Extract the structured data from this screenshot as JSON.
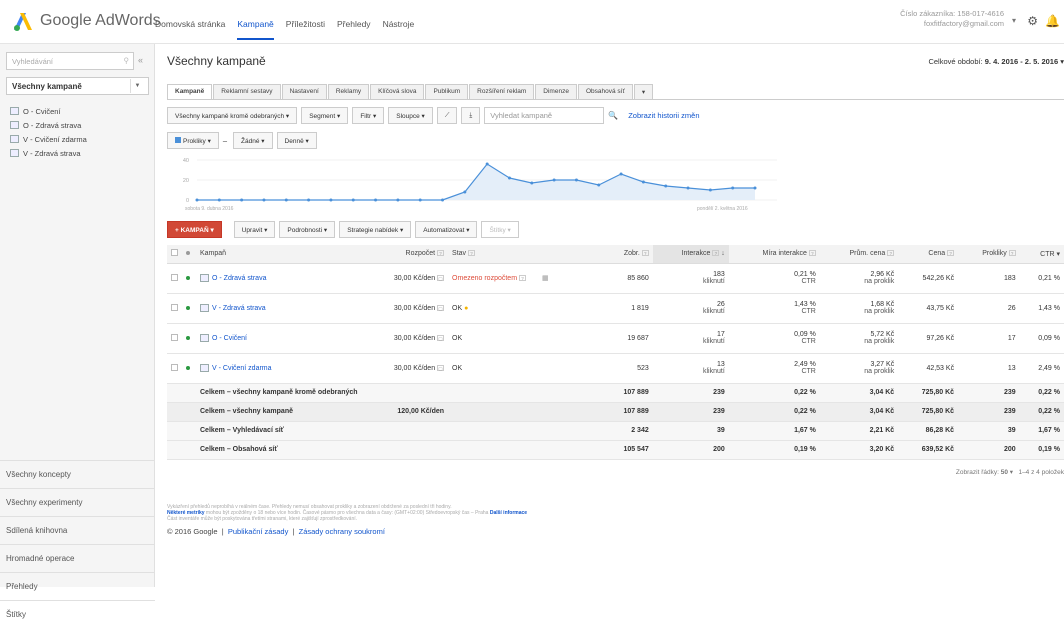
{
  "topbar": {
    "logo_text": "Google AdWords",
    "nav": [
      "Domovská stránka",
      "Kampaně",
      "Příležitosti",
      "Přehledy",
      "Nástroje"
    ],
    "active_nav": "Kampaně",
    "customer_id": "Číslo zákazníka: 158-017-4616",
    "email": "foxfitfactory@gmail.com"
  },
  "sidebar": {
    "search_placeholder": "Vyhledávání",
    "all_campaigns": "Všechny kampaně",
    "campaigns": [
      "O - Cvičení",
      "O - Zdravá strava",
      "V - Cvičení zdarma",
      "V - Zdravá strava"
    ],
    "bottom": [
      "Všechny koncepty",
      "Všechny experimenty",
      "Sdílená knihovna",
      "Hromadné operace",
      "Přehledy",
      "Štítky"
    ]
  },
  "main": {
    "title": "Všechny kampaně",
    "period_label": "Celkové období:",
    "period_value": "9. 4. 2016 - 2. 5. 2016",
    "tabs": [
      "Kampaně",
      "Reklamní sestavy",
      "Nastavení",
      "Reklamy",
      "Klíčová slova",
      "Publikum",
      "Rozšíření reklam",
      "Dimenze",
      "Obsahová síť"
    ],
    "filter_btn": "Všechny kampaně kromě odebraných",
    "segment_btn": "Segment",
    "filter2_btn": "Filtr",
    "columns_btn": "Sloupce",
    "search_placeholder": "Vyhledat kampaně",
    "history_link": "Zobrazit historii změn",
    "metric1": "Prokliky",
    "metric_sep": "–",
    "metric2": "Žádné",
    "interval": "Denně",
    "chart_start": "sobota 9. dubna 2016",
    "chart_end": "pondělí 2. května 2016",
    "y_ticks": [
      "40",
      "20",
      "0"
    ],
    "add_campaign": "+ KAMPAŇ",
    "edit_btn": "Upravit",
    "details_btn": "Podrobnosti",
    "bid_strategy_btn": "Strategie nabídek",
    "automate_btn": "Automatizovat",
    "labels_btn": "Štítky"
  },
  "chart_data": {
    "type": "line",
    "x_start": "2016-04-09",
    "x_end": "2016-05-02",
    "values": [
      0,
      0,
      0,
      0,
      0,
      0,
      0,
      0,
      0,
      0,
      0,
      0,
      8,
      36,
      22,
      17,
      20,
      20,
      15,
      26,
      18,
      14,
      12,
      10,
      12,
      12
    ],
    "ylim": [
      0,
      40
    ]
  },
  "table": {
    "headers": [
      "Kampaň",
      "Rozpočet",
      "Stav",
      "Zobr.",
      "Interakce",
      "Míra interakce",
      "Prům. cena",
      "Cena",
      "Prokliky",
      "CTR"
    ],
    "rows": [
      {
        "name": "O - Zdravá strava",
        "budget": "30,00 Kč/den",
        "status": "Omezeno rozpočtem",
        "impr": "85 860",
        "inter": "183",
        "inter_sub": "kliknutí",
        "rate": "0,21 %",
        "rate_sub": "CTR",
        "avg": "2,96 Kč",
        "avg_sub": "na proklik",
        "cost": "542,26 Kč",
        "clicks": "183",
        "ctr": "0,21 %"
      },
      {
        "name": "V - Zdravá strava",
        "budget": "30,00 Kč/den",
        "status": "OK",
        "impr": "1 819",
        "inter": "26",
        "inter_sub": "kliknutí",
        "rate": "1,43 %",
        "rate_sub": "CTR",
        "avg": "1,68 Kč",
        "avg_sub": "na proklik",
        "cost": "43,75 Kč",
        "clicks": "26",
        "ctr": "1,43 %"
      },
      {
        "name": "O - Cvičení",
        "budget": "30,00 Kč/den",
        "status": "OK",
        "impr": "19 687",
        "inter": "17",
        "inter_sub": "kliknutí",
        "rate": "0,09 %",
        "rate_sub": "CTR",
        "avg": "5,72 Kč",
        "avg_sub": "na proklik",
        "cost": "97,26 Kč",
        "clicks": "17",
        "ctr": "0,09 %"
      },
      {
        "name": "V - Cvičení zdarma",
        "budget": "30,00 Kč/den",
        "status": "OK",
        "impr": "523",
        "inter": "13",
        "inter_sub": "kliknutí",
        "rate": "2,49 %",
        "rate_sub": "CTR",
        "avg": "3,27 Kč",
        "avg_sub": "na proklik",
        "cost": "42,53 Kč",
        "clicks": "13",
        "ctr": "2,49 %"
      }
    ],
    "totals": [
      {
        "label": "Celkem – všechny kampaně kromě odebraných",
        "budget": "",
        "impr": "107 889",
        "inter": "239",
        "rate": "0,22 %",
        "avg": "3,04 Kč",
        "cost": "725,80 Kč",
        "clicks": "239",
        "ctr": "0,22 %"
      },
      {
        "label": "Celkem – všechny kampaně",
        "budget": "120,00 Kč/den",
        "impr": "107 889",
        "inter": "239",
        "rate": "0,22 %",
        "avg": "3,04 Kč",
        "cost": "725,80 Kč",
        "clicks": "239",
        "ctr": "0,22 %"
      },
      {
        "label": "Celkem – Vyhledávací síť",
        "budget": "",
        "impr": "2 342",
        "inter": "39",
        "rate": "1,67 %",
        "avg": "2,21 Kč",
        "cost": "86,28 Kč",
        "clicks": "39",
        "ctr": "1,67 %"
      },
      {
        "label": "Celkem – Obsahová síť",
        "budget": "",
        "impr": "105 547",
        "inter": "200",
        "rate": "0,19 %",
        "avg": "3,20 Kč",
        "cost": "639,52 Kč",
        "clicks": "200",
        "ctr": "0,19 %"
      }
    ],
    "pager_label": "Zobrazit řádky:",
    "pager_rows": "50",
    "pager_range": "1–4 z 4 položek"
  },
  "footer": {
    "line1": "Vykázření přehledů neprobíhá v reálném čase. Přehledy nemusí obsahovat prokliky a zobrazení obdržené za poslední tři hodiny.",
    "line2_bold": "Některé metriky",
    "line2": "mohou být zpožděny o 18 nebo více hodin. Časové pásmo pro všechna data a časy: (GMT+02:00) Středoevropský čas – Praha",
    "line2_link": "Další informace",
    "line3": "Část inventáře může být poskytována třetími stranami, které zajišťují zprostředkování.",
    "copyright": "© 2016 Google",
    "policy": "Publikační zásady",
    "privacy": "Zásady ochrany soukromí"
  },
  "colors": {
    "accent": "#1155cc",
    "add_button": "#d14836",
    "status_limited": "#dd4b39",
    "status_dot": "#2b9940",
    "chart_line": "#4a90d9"
  }
}
